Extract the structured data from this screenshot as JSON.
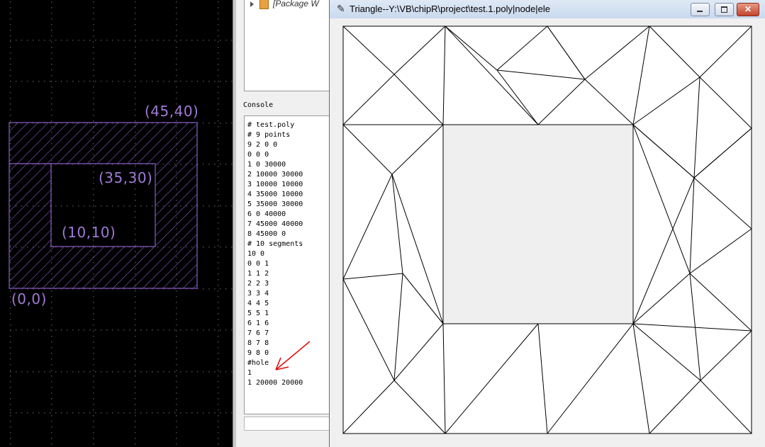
{
  "cad_canvas": {
    "labels": {
      "outer_top_right": "(45,40)",
      "inner_top_right": "(35,30)",
      "inner_bottom_left": "(10,10)",
      "origin": "(0,0)"
    },
    "colors": {
      "background": "#000000",
      "grid_dots": "#4a4a4a",
      "geometry": "#8a5cc7"
    }
  },
  "ide_panel": {
    "package_tree_item": "[Package W",
    "console_title": "Console",
    "console_lines": [
      "# test.poly",
      "# 9 points",
      "9 2 0 0",
      "0 0 0",
      "1 0 30000",
      "2 10000 30000",
      "3 10000 10000",
      "4 35000 10000",
      "5 35000 30000",
      "6 0 40000",
      "7 45000 40000",
      "8 45000 0",
      "# 10 segments",
      "10 0",
      "0 0 1",
      "1 1 2",
      "2 2 3",
      "3 3 4",
      "4 4 5",
      "5 5 1",
      "6 1 6",
      "7 6 7",
      "8 7 8",
      "9 8 0",
      "#hole",
      "1",
      "1 20000 20000"
    ],
    "annotation_arrow_color": "#e01010"
  },
  "triangle_window": {
    "title": "Triangle--Y:\\VB\\chipR\\project\\test.1.poly|node|ele",
    "icon": "feather-icon",
    "buttons": {
      "minimize": "minimize-icon",
      "maximize": "maximize-icon",
      "close": "close-icon",
      "close_glyph": "✕"
    },
    "colors": {
      "mesh_background": "#ffffff",
      "hole_fill": "#efefef",
      "edges": "#000000"
    }
  }
}
